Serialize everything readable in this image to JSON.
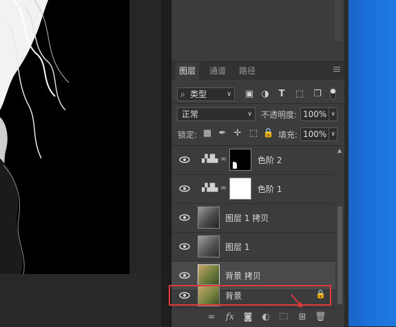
{
  "tabs": [
    {
      "label": "图层",
      "active": true
    },
    {
      "label": "通道",
      "active": false
    },
    {
      "label": "路径",
      "active": false
    }
  ],
  "filter": {
    "kind_label": "类型"
  },
  "blend": {
    "mode": "正常",
    "opacity_label": "不透明度:",
    "opacity_value": "100%"
  },
  "lock": {
    "label": "锁定:",
    "fill_label": "填充:",
    "fill_value": "100%"
  },
  "layers": [
    {
      "name": "色阶 2",
      "type": "adjustment",
      "visible": true,
      "mask": "black-with-white-corner"
    },
    {
      "name": "色阶 1",
      "type": "adjustment",
      "visible": true,
      "mask": "white"
    },
    {
      "name": "图层 1 拷贝",
      "type": "pixel",
      "visible": true,
      "thumb": "grayscale"
    },
    {
      "name": "图层 1",
      "type": "pixel",
      "visible": true,
      "thumb": "grayscale"
    },
    {
      "name": "背景 拷贝",
      "type": "pixel",
      "visible": true,
      "thumb": "color",
      "selected": true
    },
    {
      "name": "背景",
      "type": "background",
      "visible": true,
      "thumb": "color",
      "locked": true,
      "highlighted": true
    }
  ],
  "colors": {
    "highlight": "#e03a3a",
    "panel": "#3c3c3c",
    "selected_row": "#4a4a4a"
  }
}
